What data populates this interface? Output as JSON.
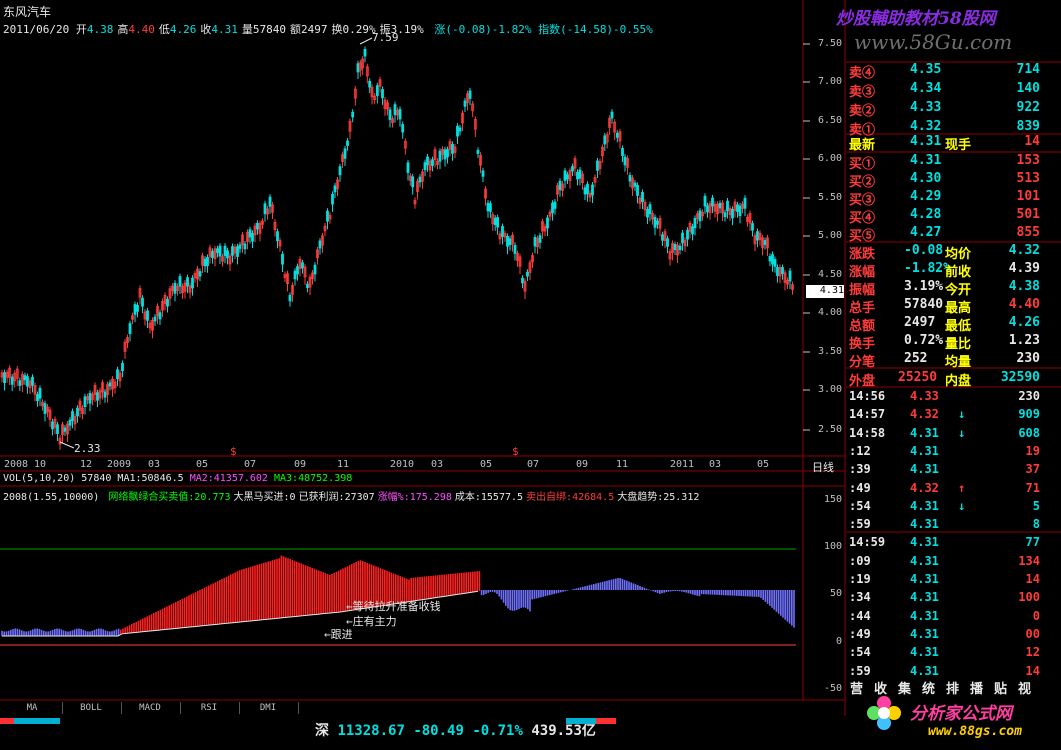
{
  "header": {
    "title": "东风汽车",
    "date": "2011/06/20",
    "items": [
      {
        "label": "开",
        "value": "4.38",
        "color": "#00e0e0"
      },
      {
        "label": "高",
        "value": "4.40",
        "color": "#ff3c3c"
      },
      {
        "label": "低",
        "value": "4.26",
        "color": "#00e0e0"
      },
      {
        "label": "收",
        "value": "4.31",
        "color": "#00e0e0"
      },
      {
        "label": "量",
        "value": "57840",
        "color": "#e8e8e8"
      },
      {
        "label": "额",
        "value": "2497",
        "color": "#e8e8e8"
      },
      {
        "label": "换",
        "value": "0.29%",
        "color": "#e8e8e8"
      },
      {
        "label": "振",
        "value": "3.19%",
        "color": "#e8e8e8"
      }
    ],
    "change_text": "涨(-0.08)-1.82%",
    "index_text": "指数(-14.58)-0.55%"
  },
  "watermark_top": "炒股輔助教材58股网",
  "watermark_url": "www.58Gu.com",
  "watermark_bottom": "分析家公式网",
  "watermark_bottom_url": "www.88gs.com",
  "price_axis": [
    "7.50",
    "7.00",
    "6.50",
    "6.00",
    "5.50",
    "5.00",
    "4.50",
    "4.00",
    "3.50",
    "3.00",
    "2.50"
  ],
  "price_marker": "4.31",
  "peak_label": "7.59",
  "low_label": "2.33",
  "date_axis": [
    "2008",
    "10",
    "12",
    "2009",
    "03",
    "05",
    "07",
    "09",
    "11",
    "2010",
    "03",
    "05",
    "07",
    "09",
    "11",
    "2011",
    "03",
    "05"
  ],
  "period_label": "日线",
  "vol_line": {
    "name": "VOL(5,10,20)",
    "vol": "57840",
    "ma1": "MA1:50846.5",
    "ma2": "MA2:41357.602",
    "ma3": "MA3:48752.398"
  },
  "indicator_line": {
    "name": "2008(1.55,10000)",
    "items": [
      {
        "text": "网络飘绿合买卖值:20.773",
        "color": "#00ff00"
      },
      {
        "text": "大黑马买进:0",
        "color": "#e8e8e8"
      },
      {
        "text": "已获利润:27307",
        "color": "#e8e8e8"
      },
      {
        "text": "涨幅%:175.298",
        "color": "#ff50ff"
      },
      {
        "text": "成本:15577.5",
        "color": "#e8e8e8"
      },
      {
        "text": "卖出自绑:42684.5",
        "color": "#ff3c3c"
      },
      {
        "text": "大盘趋势:25.312",
        "color": "#e8e8e8"
      }
    ]
  },
  "indicator_axis": [
    "150",
    "100",
    "50",
    "0",
    "-50"
  ],
  "annotations": [
    "等待拉升准备收钱",
    "庄有主力",
    "跟进"
  ],
  "order_book": {
    "sell": [
      {
        "label": "卖④",
        "price": "4.35",
        "vol": "714"
      },
      {
        "label": "卖③",
        "price": "4.34",
        "vol": "140"
      },
      {
        "label": "卖②",
        "price": "4.33",
        "vol": "922"
      },
      {
        "label": "卖①",
        "price": "4.32",
        "vol": "839"
      }
    ],
    "latest": {
      "label": "最新",
      "price": "4.31",
      "label2": "现手",
      "vol": "14"
    },
    "buy": [
      {
        "label": "买①",
        "price": "4.31",
        "vol": "153"
      },
      {
        "label": "买②",
        "price": "4.30",
        "vol": "513"
      },
      {
        "label": "买③",
        "price": "4.29",
        "vol": "101"
      },
      {
        "label": "买④",
        "price": "4.28",
        "vol": "501"
      },
      {
        "label": "买⑤",
        "price": "4.27",
        "vol": "855"
      }
    ]
  },
  "stats": [
    {
      "l1": "涨跌",
      "v1": "-0.08",
      "l2": "均价",
      "v2": "4.32",
      "c1": "#00e0e0",
      "c2": "#00e0e0"
    },
    {
      "l1": "涨幅",
      "v1": "-1.82%",
      "l2": "前收",
      "v2": "4.39",
      "c1": "#00e0e0",
      "c2": "#e8e8e8"
    },
    {
      "l1": "振幅",
      "v1": "3.19%",
      "l2": "今开",
      "v2": "4.38",
      "c1": "#e8e8e8",
      "c2": "#00e0e0"
    },
    {
      "l1": "总手",
      "v1": "57840",
      "l2": "最高",
      "v2": "4.40",
      "c1": "#e8e8e8",
      "c2": "#ff3c3c"
    },
    {
      "l1": "总额",
      "v1": "2497",
      "l2": "最低",
      "v2": "4.26",
      "c1": "#e8e8e8",
      "c2": "#00e0e0"
    },
    {
      "l1": "换手",
      "v1": "0.72%",
      "l2": "量比",
      "v2": "1.23",
      "c1": "#e8e8e8",
      "c2": "#e8e8e8"
    },
    {
      "l1": "分笔",
      "v1": "252",
      "l2": "均量",
      "v2": "230",
      "c1": "#e8e8e8",
      "c2": "#e8e8e8"
    }
  ],
  "outer_inner": {
    "l1": "外盘",
    "v1": "25250",
    "l2": "内盘",
    "v2": "32590"
  },
  "ticks": [
    {
      "time": "14:56",
      "price": "4.33",
      "arrow": "",
      "vol": "230",
      "vc": "#e8e8e8"
    },
    {
      "time": "14:57",
      "price": "4.32",
      "arrow": "down",
      "vol": "909",
      "vc": "#00e0e0"
    },
    {
      "time": "14:58",
      "price": "4.31",
      "arrow": "down",
      "vol": "608",
      "vc": "#00e0e0"
    },
    {
      "time": ":12",
      "price": "4.31",
      "arrow": "",
      "vol": "19",
      "vc": "#ff3c3c"
    },
    {
      "time": ":39",
      "price": "4.31",
      "arrow": "",
      "vol": "37",
      "vc": "#ff3c3c"
    },
    {
      "time": ":49",
      "price": "4.32",
      "arrow": "up",
      "vol": "71",
      "vc": "#ff3c3c"
    },
    {
      "time": ":54",
      "price": "4.31",
      "arrow": "down",
      "vol": "5",
      "vc": "#00e0e0"
    },
    {
      "time": ":59",
      "price": "4.31",
      "arrow": "",
      "vol": "8",
      "vc": "#00e0e0"
    },
    {
      "time": "14:59",
      "price": "4.31",
      "arrow": "",
      "vol": "77",
      "vc": "#00e0e0"
    },
    {
      "time": ":09",
      "price": "4.31",
      "arrow": "",
      "vol": "134",
      "vc": "#ff3c3c"
    },
    {
      "time": ":19",
      "price": "4.31",
      "arrow": "",
      "vol": "14",
      "vc": "#ff3c3c"
    },
    {
      "time": ":34",
      "price": "4.31",
      "arrow": "",
      "vol": "100",
      "vc": "#ff3c3c"
    },
    {
      "time": ":44",
      "price": "4.31",
      "arrow": "",
      "vol": "0",
      "vc": "#ff3c3c"
    },
    {
      "time": ":49",
      "price": "4.31",
      "arrow": "",
      "vol": "00",
      "vc": "#ff3c3c"
    },
    {
      "time": ":54",
      "price": "4.31",
      "arrow": "",
      "vol": "12",
      "vc": "#ff3c3c"
    },
    {
      "time": ":59",
      "price": "4.31",
      "arrow": "",
      "vol": "14",
      "vc": "#ff3c3c"
    }
  ],
  "right_tabs": [
    "营",
    "收",
    "集",
    "统",
    "排",
    "播",
    "贴",
    "视"
  ],
  "tabs": [
    "MA",
    "BOLL",
    "MACD",
    "RSI",
    "DMI"
  ],
  "status_bar": {
    "market": "深",
    "index": "11328.67",
    "change": "-80.49",
    "pct": "-0.71%",
    "amount": "439.53亿"
  },
  "colors": {
    "up": "#ff3c3c",
    "down": "#00e0e0",
    "indicator_up": "#ff2020",
    "indicator_down": "#7070ff",
    "grid": "#8b0000"
  }
}
